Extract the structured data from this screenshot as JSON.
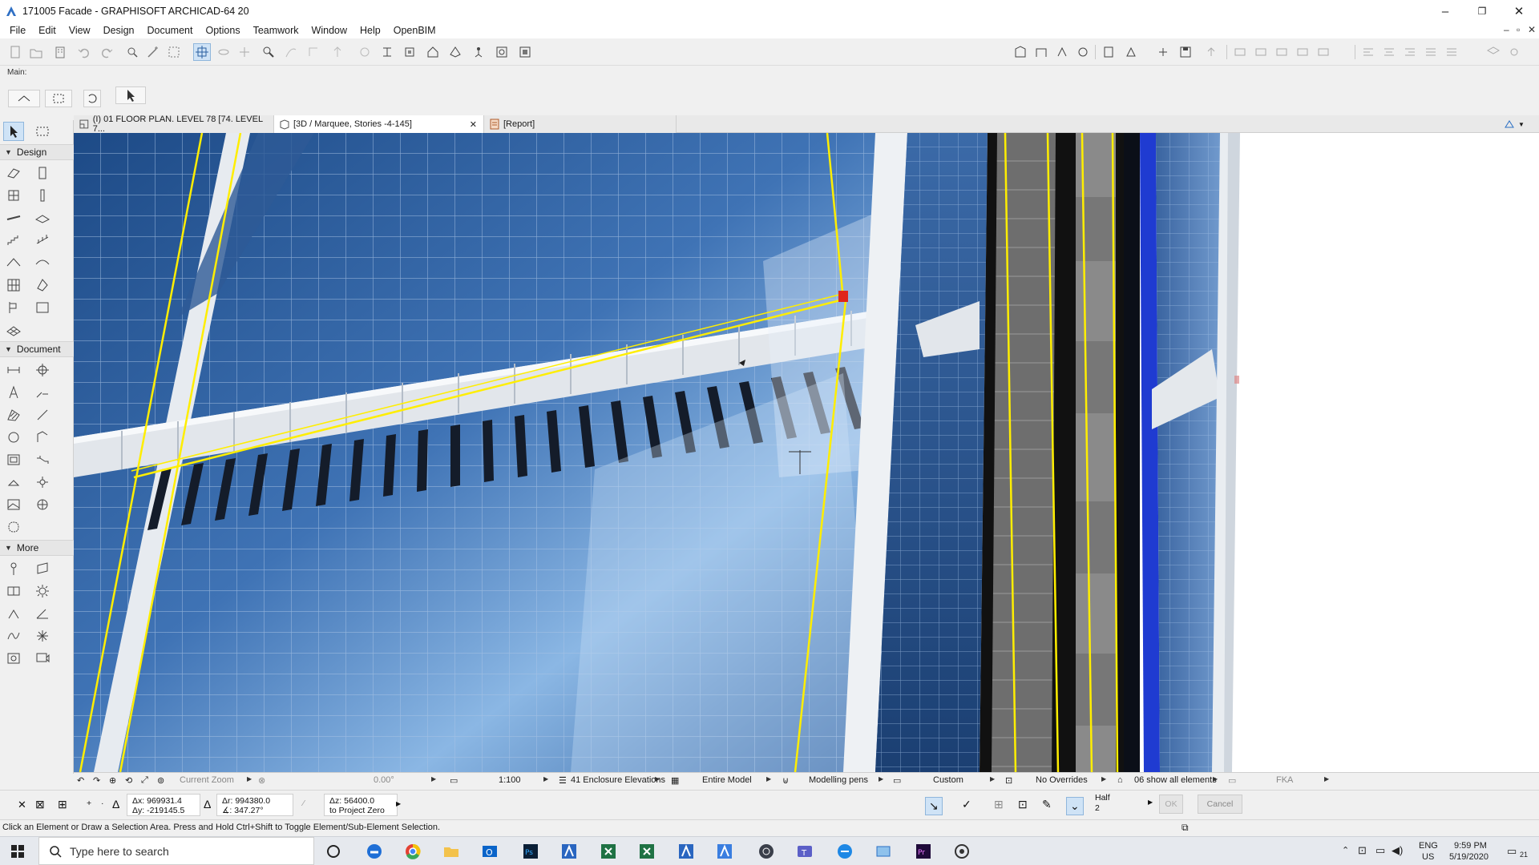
{
  "window": {
    "title": "171005 Facade - GRAPHISOFT ARCHICAD-64 20",
    "controls": [
      "–",
      "❐",
      "✕"
    ]
  },
  "menu": [
    "File",
    "Edit",
    "View",
    "Design",
    "Document",
    "Options",
    "Teamwork",
    "Window",
    "Help",
    "OpenBIM"
  ],
  "toolbar": {
    "main_label": "Main:"
  },
  "toolbox": {
    "sections": [
      {
        "label": "Design"
      },
      {
        "label": "Document"
      },
      {
        "label": "More"
      }
    ]
  },
  "tabs": [
    {
      "label": "(I) 01 FLOOR PLAN. LEVEL 78 [74. LEVEL 7...",
      "active": false
    },
    {
      "label": "[3D / Marquee, Stories -4-145]",
      "active": true,
      "close": "✕"
    },
    {
      "label": "[Report]",
      "active": false
    }
  ],
  "viewbar": {
    "zoom": "Current Zoom",
    "angle": "0.00°",
    "scale": "1:100",
    "layers": "41 Enclosure Elevations",
    "model": "Entire Model",
    "pens": "Modelling pens",
    "mvo": "Custom",
    "overrides": "No Overrides",
    "renovation": "06 show all elements",
    "right": "FKA"
  },
  "coords": {
    "ax": "Δx: 969931.4",
    "ay": "Δy: -219145.5",
    "ar": "Δr: 994380.0",
    "angle": "∡: 347.27°",
    "az": "Δz: 56400.0",
    "ref": "to Project Zero",
    "half": "Half",
    "half_n": "2",
    "ok": "OK",
    "cancel": "Cancel"
  },
  "status": "Click an Element or Draw a Selection Area. Press and Hold Ctrl+Shift to Toggle Element/Sub-Element Selection.",
  "taskbar": {
    "search_placeholder": "Type here to search",
    "lang": "ENG",
    "region": "US",
    "time": "9:59 PM",
    "date": "5/19/2020",
    "notif": "21"
  },
  "colors": {
    "glass_dark": "#1f4e8c",
    "glass_mid": "#3f75b8",
    "glass_light": "#9cc3ea",
    "selection": "#ffee00",
    "hotspot": "#e0251b",
    "band": "#dfe4ea"
  }
}
